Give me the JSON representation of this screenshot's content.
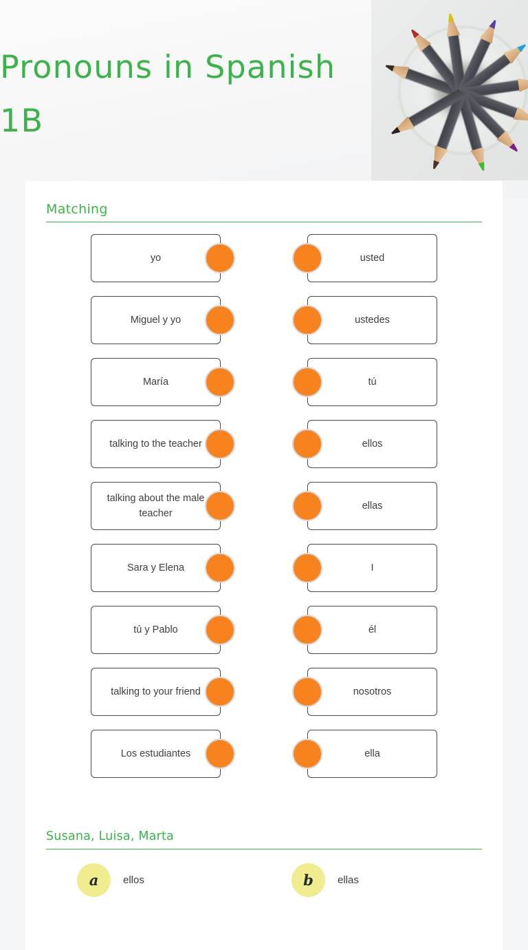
{
  "header": {
    "title": "Pronouns in Spanish 1B",
    "photo_alt": "colored-pencils-in-glass-top-view",
    "title_color": "#3cb34a",
    "background_color": "#f6f6f7"
  },
  "theme": {
    "accent_green": "#3cb34a",
    "dot_orange": "#f7821e",
    "badge_yellow": "#f0ec90",
    "card_border": "#4a4a4a",
    "page_background": "#f4f5f7",
    "panel_background": "#ffffff"
  },
  "matching": {
    "section_label": "Matching",
    "rows": [
      {
        "left": "yo",
        "right": "usted"
      },
      {
        "left": "Miguel y yo",
        "right": "ustedes"
      },
      {
        "left": "María",
        "right": "tú"
      },
      {
        "left": "talking to the teacher",
        "right": "ellos"
      },
      {
        "left": "talking about the male teacher",
        "right": "ellas"
      },
      {
        "left": "Sara y Elena",
        "right": "I"
      },
      {
        "left": "tú y Pablo",
        "right": "él"
      },
      {
        "left": "talking to your friend",
        "right": "nosotros"
      },
      {
        "left": "Los estudiantes",
        "right": "ella"
      }
    ]
  },
  "question": {
    "prompt": "Susana, Luisa, Marta",
    "options": [
      {
        "letter": "a",
        "label": "ellos"
      },
      {
        "letter": "b",
        "label": "ellas"
      }
    ]
  },
  "pencils": [
    {
      "angle": 200,
      "tip": "#3b2a20"
    },
    {
      "angle": 232,
      "tip": "#b02b2b"
    },
    {
      "angle": 262,
      "tip": "#d4c316"
    },
    {
      "angle": 295,
      "tip": "#5a3fa0"
    },
    {
      "angle": 323,
      "tip": "#1fa3d8"
    },
    {
      "angle": 352,
      "tip": "#1b4fa8"
    },
    {
      "angle": 20,
      "tip": "#e8369b"
    },
    {
      "angle": 46,
      "tip": "#7b1f86"
    },
    {
      "angle": 74,
      "tip": "#3fbb2f"
    },
    {
      "angle": 110,
      "tip": "#4a3326"
    },
    {
      "angle": 150,
      "tip": "#2e2118"
    }
  ]
}
